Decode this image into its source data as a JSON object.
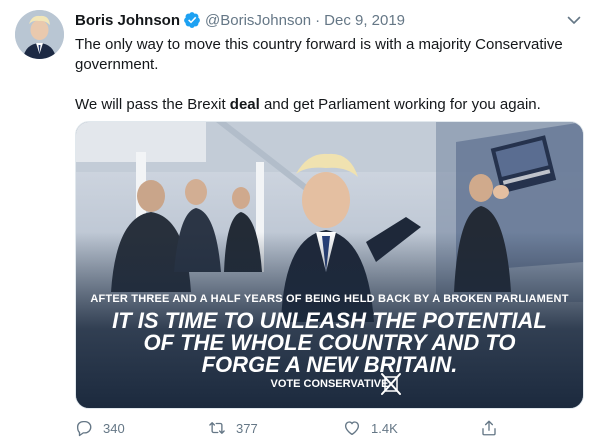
{
  "author": {
    "name": "Boris Johnson",
    "handle": "@BorisJohnson",
    "separator": "·",
    "date": "Dec 9, 2019",
    "verified_icon": "verified-badge-icon"
  },
  "tweet": {
    "line1": "The only way to move this country forward is with a majority Conservative government.",
    "line2_before": "We will pass the Brexit ",
    "line2_bold": "deal",
    "line2_after": " and get Parliament working for you again."
  },
  "poster": {
    "subtitle": "AFTER THREE AND A HALF YEARS OF BEING HELD BACK BY A BROKEN PARLIAMENT",
    "headline1": "IT IS TIME TO UNLEASH THE POTENTIAL",
    "headline2": "OF THE WHOLE COUNTRY AND TO",
    "headline3": "FORGE A NEW BRITAIN.",
    "vote": "VOTE CONSERVATIVE"
  },
  "actions": {
    "reply_count": "340",
    "retweet_count": "377",
    "like_count": "1.4K"
  },
  "colors": {
    "text": "#14171a",
    "secondary": "#657786",
    "verified": "#1da1f2",
    "poster_bg": "#1c2a3e"
  }
}
